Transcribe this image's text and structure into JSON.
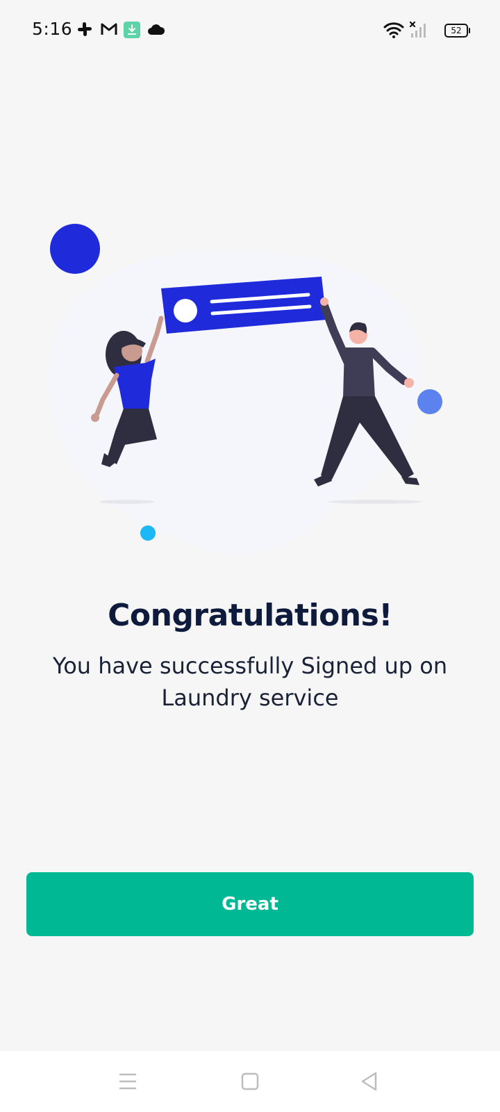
{
  "status_bar": {
    "time": "5:16",
    "battery": "52",
    "notification_icons": [
      "slack-icon",
      "gmail-icon",
      "download-icon",
      "cloud-icon"
    ],
    "system_icons": [
      "wifi-icon",
      "no-signal-icon",
      "battery-icon"
    ]
  },
  "illustration": {
    "name": "celebration-illustration",
    "colors": {
      "accent": "#1f2adb",
      "accent_light": "#5b82ee",
      "cyan": "#1bb8f5",
      "blob": "#f5f6fb",
      "dark": "#2f2e41"
    }
  },
  "content": {
    "title": "Congratulations!",
    "subtitle": "You have successfully Signed up on Laundry service"
  },
  "actions": {
    "primary_label": "Great",
    "primary_color": "#00b894"
  },
  "nav_bar": {
    "buttons": [
      "menu-icon",
      "home-icon",
      "back-icon"
    ]
  }
}
